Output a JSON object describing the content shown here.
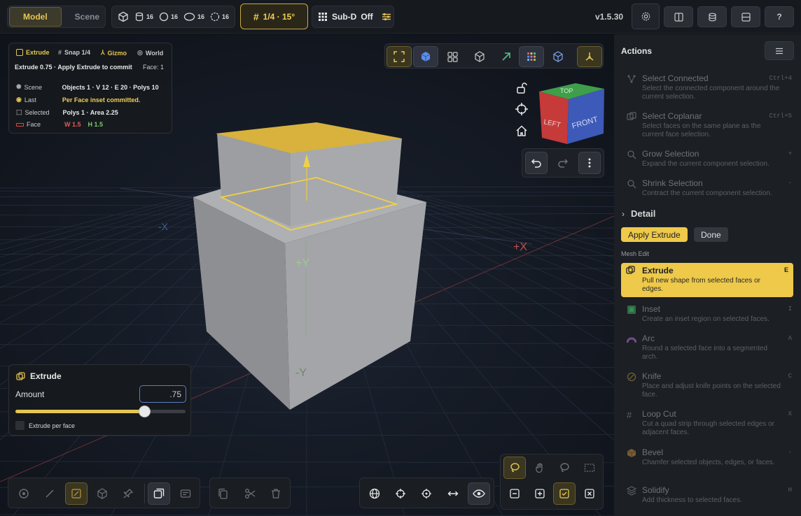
{
  "topbar": {
    "modes": [
      "Model",
      "Scene"
    ],
    "active_mode": "Model",
    "stats": [
      "16",
      "16",
      "16",
      "16"
    ],
    "snap": "1/4 · 15°",
    "subd_label": "Sub-D",
    "subd_state": "Off",
    "version": "v1.5.30",
    "help": "?"
  },
  "info": {
    "mode": "Extrude",
    "snap": "Snap 1/4",
    "gizmo": "Gizmo",
    "space": "World",
    "hint": "Extrude 0.75 · Apply Extrude to commit",
    "face": "Face: 1",
    "rows": [
      {
        "label": "Scene",
        "value": "Objects 1 · V 12 · E 20 · Polys 10"
      },
      {
        "label": "Last",
        "value": "Per Face inset committed."
      },
      {
        "label": "Selected",
        "value": "Polys 1 · Area 2.25"
      },
      {
        "label": "Face",
        "w": "W 1.5",
        "h": "H 1.5"
      }
    ]
  },
  "viewcube": {
    "top": "TOP",
    "left": "LEFT",
    "front": "FRONT"
  },
  "axis_labels": {
    "y_pos": "+Y",
    "x_pos": "+X",
    "y_neg": "-Y",
    "x_neg": "-X"
  },
  "extrude_panel": {
    "title": "Extrude",
    "amount_label": "Amount",
    "amount_value": ".75",
    "amount_fraction": 0.75,
    "per_face_label": "Extrude per face"
  },
  "sidebar": {
    "title": "Actions",
    "actions_top": [
      {
        "title": "Select Connected",
        "desc": "Select the connected component around the current selection.",
        "key": "Ctrl+4"
      },
      {
        "title": "Select Coplanar",
        "desc": "Select faces on the same plane as the current face selection.",
        "key": "Ctrl+5"
      },
      {
        "title": "Grow Selection",
        "desc": "Expand the current component selection.",
        "key": "+"
      },
      {
        "title": "Shrink Selection",
        "desc": "Contract the current component selection.",
        "key": "-"
      }
    ],
    "detail_label": "Detail",
    "apply_label": "Apply Extrude",
    "done_label": "Done",
    "section_label": "Mesh Edit",
    "mesh_actions": [
      {
        "title": "Extrude",
        "desc": "Pull new shape from selected faces or edges.",
        "key": "E"
      },
      {
        "title": "Inset",
        "desc": "Create an inset region on selected faces.",
        "key": "I"
      },
      {
        "title": "Arc",
        "desc": "Round a selected face into a segmented arch.",
        "key": "A"
      },
      {
        "title": "Knife",
        "desc": "Place and adjust knife points on the selected face.",
        "key": "C"
      },
      {
        "title": "Loop Cut",
        "desc": "Cut a quad strip through selected edges or adjacent faces.",
        "key": "X"
      },
      {
        "title": "Bevel",
        "desc": "Chamfer selected objects, edges, or faces.",
        "key": "-"
      },
      {
        "title": "Solidify",
        "desc": "Add thickness to selected faces.",
        "key": "H"
      }
    ]
  }
}
